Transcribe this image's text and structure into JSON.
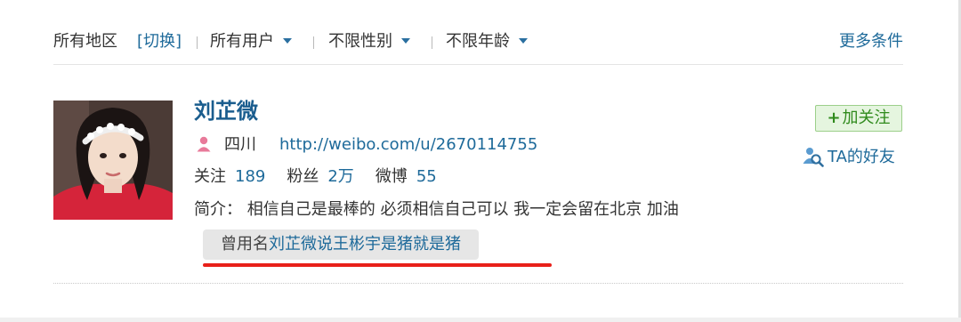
{
  "filters": {
    "region": "所有地区",
    "switch": "[切换]",
    "users": "所有用户",
    "gender": "不限性别",
    "age": "不限年龄",
    "more": "更多条件"
  },
  "user": {
    "name": "刘芷微",
    "location": "四川",
    "url": "http://weibo.com/u/2670114755",
    "following_label": "关注",
    "following_count": "189",
    "followers_label": "粉丝",
    "followers_count": "2万",
    "posts_label": "微博",
    "posts_count": "55",
    "bio_label": "简介：",
    "bio": "相信自己是最棒的 必须相信自己可以 我一定会留在北京 加油",
    "former_name_label": "曾用名",
    "former_name": "刘芷微说王彬宇是猪就是猪"
  },
  "actions": {
    "follow": "加关注",
    "friends": "TA的好友"
  },
  "colors": {
    "link": "#1e6a9a",
    "name": "#1a5d8e",
    "follow_bg": "#e5f5df",
    "follow_text": "#2f8a1c",
    "highlight_underline": "#e8201a",
    "gender_icon": "#e87a9a"
  },
  "icons": {
    "gender": "female-user-icon",
    "friends": "find-friends-icon",
    "dropdown": "caret-down-icon"
  }
}
